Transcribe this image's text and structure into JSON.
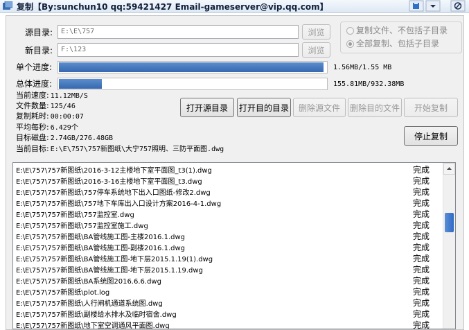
{
  "window": {
    "title": "复制【By:sunchun10 qq:59421427 Email-gameserver@vip.qq.com】"
  },
  "form": {
    "source_label": "源目录:",
    "source_value": "E:\\E\\757",
    "dest_label": "新目录:",
    "dest_value": "F:\\123",
    "browse_label": "浏览",
    "option_no_subdirs": "复制文件、不包括子目录",
    "option_all_subdirs": "全部复制、包括子目录",
    "selected_option": "option_all_subdirs"
  },
  "progress": {
    "single_label": "单个进度:",
    "single_fraction": 0.99,
    "single_text": "1.56MB/1.55 MB",
    "total_label": "总体进度:",
    "total_fraction": 0.166,
    "total_text": "155.81MB/932.38MB"
  },
  "stats": [
    {
      "label": "当前速度:",
      "value": "11.12MB/S"
    },
    {
      "label": "文件数量:",
      "value": "125/46"
    },
    {
      "label": "复制耗时:",
      "value": "00:00:07"
    },
    {
      "label": "平均每秒:",
      "value": "6.429个"
    },
    {
      "label": "目标磁盘:",
      "value": "2.74GB/276.48GB"
    },
    {
      "label": "当前目标:",
      "value": "E:\\E\\757\\757新图纸\\大宁757照明、三防平面图.dwg"
    }
  ],
  "buttons": {
    "open_source": "打开源目录",
    "open_dest": "打开目的目录",
    "delete_source": "删除源文件",
    "delete_dest": "删除目的文件",
    "start_copy": "开始复制",
    "stop_copy": "停止复制"
  },
  "file_list": [
    {
      "path": "E:\\E\\757\\757新图纸\\2016-3-12主楼地下室平面图_t3(1).dwg",
      "status": "完成"
    },
    {
      "path": "E:\\E\\757\\757新图纸\\2016-3-16主楼地下室平面图_t3.dwg",
      "status": "完成"
    },
    {
      "path": "E:\\E\\757\\757新图纸\\757停车系统地下出入口图纸-修改2.dwg",
      "status": "完成"
    },
    {
      "path": "E:\\E\\757\\757新图纸\\757地下车库出入口设计方案2016-4-1.dwg",
      "status": "完成"
    },
    {
      "path": "E:\\E\\757\\757新图纸\\757监控室.dwg",
      "status": "完成"
    },
    {
      "path": "E:\\E\\757\\757新图纸\\757监控室施工.dwg",
      "status": "完成"
    },
    {
      "path": "E:\\E\\757\\757新图纸\\BA管线施工图-主楼2016.1.dwg",
      "status": "完成"
    },
    {
      "path": "E:\\E\\757\\757新图纸\\BA管线施工图-副楼2016.1.dwg",
      "status": "完成"
    },
    {
      "path": "E:\\E\\757\\757新图纸\\BA管线施工图-地下层2015.1.19(1).dwg",
      "status": "完成"
    },
    {
      "path": "E:\\E\\757\\757新图纸\\BA管线施工图-地下层2015.1.19.dwg",
      "status": "完成"
    },
    {
      "path": "E:\\E\\757\\757新图纸\\BA系统图2016.6.6.dwg",
      "status": "完成"
    },
    {
      "path": "E:\\E\\757\\757新图纸\\plot.log",
      "status": "完成"
    },
    {
      "path": "E:\\E\\757\\757新图纸\\人行闸机通道系统图.dwg",
      "status": "完成"
    },
    {
      "path": "E:\\E\\757\\757新图纸\\副楼给水排水及临时宿舍.dwg",
      "status": "完成"
    },
    {
      "path": "E:\\E\\757\\757新图纸\\地下室空调通风平面图.dwg",
      "status": "完成"
    }
  ],
  "colors": {
    "progress_fill": "#3f72b8",
    "title_text": "#10203a"
  },
  "icons": {
    "app": "copy-app-icon",
    "minimize": "minimize-icon",
    "close": "close-icon"
  }
}
